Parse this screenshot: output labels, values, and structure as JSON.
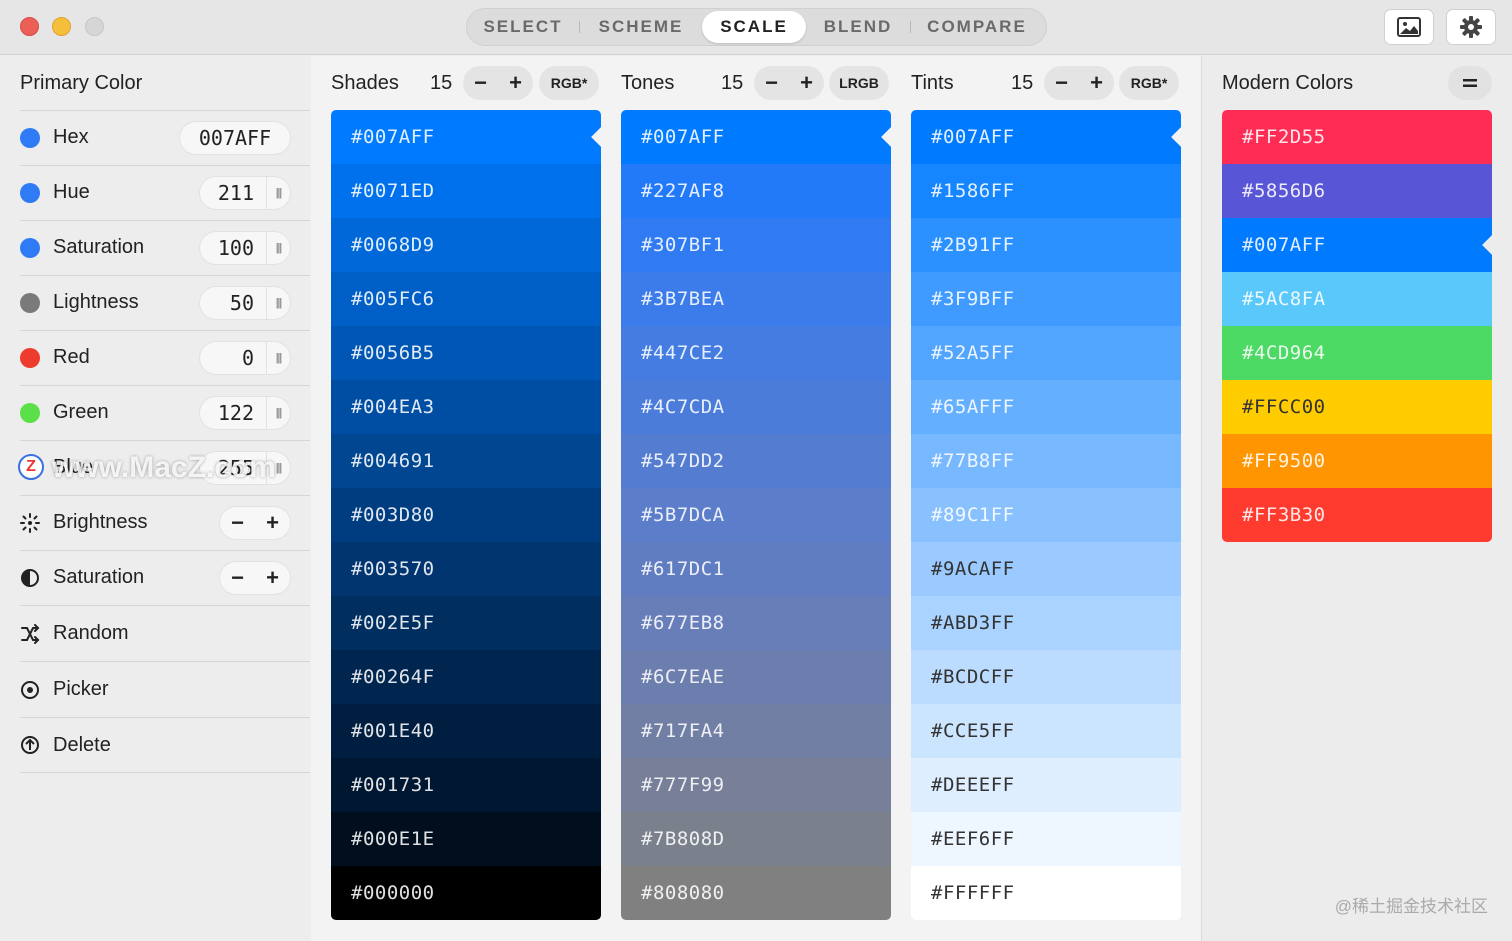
{
  "toolbar": {
    "tabs": [
      "SELECT",
      "SCHEME",
      "SCALE",
      "BLEND",
      "COMPARE"
    ],
    "active_tab": "SCALE",
    "image_icon": "image-icon",
    "settings_icon": "gear-icon"
  },
  "sidebar": {
    "title": "Primary Color",
    "hex": {
      "label": "Hex",
      "value": "007AFF",
      "dot": "#2f7af5"
    },
    "hue": {
      "label": "Hue",
      "value": "211",
      "dot": "#2f7af5"
    },
    "saturation": {
      "label": "Saturation",
      "value": "100",
      "dot": "#2f7af5"
    },
    "lightness": {
      "label": "Lightness",
      "value": "50",
      "dot": "#7a7a7a"
    },
    "red": {
      "label": "Red",
      "value": "0",
      "dot": "#ee3b2e"
    },
    "green": {
      "label": "Green",
      "value": "122",
      "dot": "#5ce04a"
    },
    "blue": {
      "label": "Blue",
      "value": "255",
      "dot": "#2f7af5"
    },
    "adjust_brightness": "Brightness",
    "adjust_saturation": "Saturation",
    "random": "Random",
    "picker": "Picker",
    "delete": "Delete",
    "minus": "−",
    "plus": "+"
  },
  "watermark": "www.MacZ.com",
  "watermark_badge": "Z",
  "scales": {
    "shades": {
      "title": "Shades",
      "count": "15",
      "mode": "RGB*",
      "colors": [
        "#007AFF",
        "#0071ED",
        "#0068D9",
        "#005FC6",
        "#0056B5",
        "#004EA3",
        "#004691",
        "#003D80",
        "#003570",
        "#002E5F",
        "#00264F",
        "#001E40",
        "#001731",
        "#000E1E",
        "#000000"
      ]
    },
    "tones": {
      "title": "Tones",
      "count": "15",
      "mode": "LRGB",
      "colors": [
        "#007AFF",
        "#227AF8",
        "#307BF1",
        "#3B7BEA",
        "#447CE2",
        "#4C7CDA",
        "#547DD2",
        "#5B7DCA",
        "#617DC1",
        "#677EB8",
        "#6C7EAE",
        "#717FA4",
        "#777F99",
        "#7B808D",
        "#808080"
      ]
    },
    "tints": {
      "title": "Tints",
      "count": "15",
      "mode": "RGB*",
      "colors": [
        "#007AFF",
        "#1586FF",
        "#2B91FF",
        "#3F9BFF",
        "#52A5FF",
        "#65AFFF",
        "#77B8FF",
        "#89C1FF",
        "#9ACAFF",
        "#ABD3FF",
        "#BCDCFF",
        "#CCE5FF",
        "#DEEEFF",
        "#EEF6FF",
        "#FFFFFF"
      ]
    }
  },
  "modern": {
    "title": "Modern Colors",
    "menu_icon": "=",
    "colors": [
      "#FF2D55",
      "#5856D6",
      "#007AFF",
      "#5AC8FA",
      "#4CD964",
      "#FFCC00",
      "#FF9500",
      "#FF3B30"
    ]
  },
  "credit": "@稀土掘金技术社区"
}
